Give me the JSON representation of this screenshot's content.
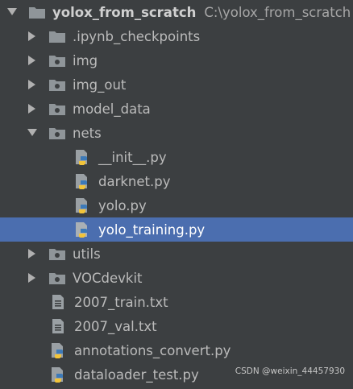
{
  "project_tree": {
    "root": {
      "name": "yolox_from_scratch",
      "path": "C:\\yolox_from_scratch",
      "icon": "folder-icon",
      "expanded": true
    },
    "items": [
      {
        "label": ".ipynb_checkpoints",
        "icon": "folder-icon",
        "kind": "folder",
        "expanded": false
      },
      {
        "label": "img",
        "icon": "package-folder-icon",
        "kind": "package",
        "expanded": false
      },
      {
        "label": "img_out",
        "icon": "package-folder-icon",
        "kind": "package",
        "expanded": false
      },
      {
        "label": "model_data",
        "icon": "package-folder-icon",
        "kind": "package",
        "expanded": false
      },
      {
        "label": "nets",
        "icon": "package-folder-icon",
        "kind": "package",
        "expanded": true
      },
      {
        "label": "__init__.py",
        "icon": "python-file-icon",
        "kind": "file"
      },
      {
        "label": "darknet.py",
        "icon": "python-file-icon",
        "kind": "file"
      },
      {
        "label": "yolo.py",
        "icon": "python-file-icon",
        "kind": "file"
      },
      {
        "label": "yolo_training.py",
        "icon": "python-file-icon",
        "kind": "file",
        "selected": true
      },
      {
        "label": "utils",
        "icon": "package-folder-icon",
        "kind": "package",
        "expanded": false
      },
      {
        "label": "VOCdevkit",
        "icon": "package-folder-icon",
        "kind": "package",
        "expanded": false
      },
      {
        "label": "2007_train.txt",
        "icon": "text-file-icon",
        "kind": "file"
      },
      {
        "label": "2007_val.txt",
        "icon": "text-file-icon",
        "kind": "file"
      },
      {
        "label": "annotations_convert.py",
        "icon": "python-file-icon",
        "kind": "file"
      },
      {
        "label": "dataloader_test.py",
        "icon": "python-file-icon",
        "kind": "file"
      }
    ]
  },
  "watermark": "CSDN @weixin_44457930",
  "colors": {
    "background": "#3c3f41",
    "selection": "#4b6eaf",
    "text": "#bbbbbb"
  }
}
